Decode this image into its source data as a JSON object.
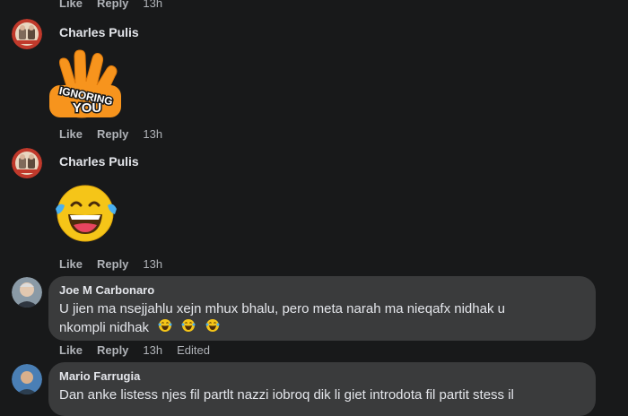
{
  "comments": [
    {
      "actions": {
        "like": "Like",
        "reply": "Reply",
        "time": "13h"
      }
    },
    {
      "author": "Charles Pulis",
      "sticker_text_line1": "IGNORING",
      "sticker_text_line2": "YOU",
      "actions": {
        "like": "Like",
        "reply": "Reply",
        "time": "13h"
      }
    },
    {
      "author": "Charles Pulis",
      "sticker": "laughing-tears-emoji",
      "actions": {
        "like": "Like",
        "reply": "Reply",
        "time": "13h"
      }
    },
    {
      "author": "Joe M Carbonaro",
      "text_line1": "U jien ma nsejjahlu xejn mhux bhalu, pero meta narah ma nieqafx nidhak u",
      "text_line2": "nkompli nidhak",
      "actions": {
        "like": "Like",
        "reply": "Reply",
        "time": "13h",
        "edited": "Edited"
      }
    },
    {
      "author": "Mario Farrugia",
      "text_line1": "Dan anke listess njes fil partlt nazzi iobroq dik li giet introdota fil partit stess il"
    }
  ],
  "colors": {
    "background": "#18191a",
    "bubble": "#3a3b3c",
    "muted_text": "#b0b3b8",
    "text": "#e4e6eb",
    "sticker_orange": "#f7941d"
  }
}
